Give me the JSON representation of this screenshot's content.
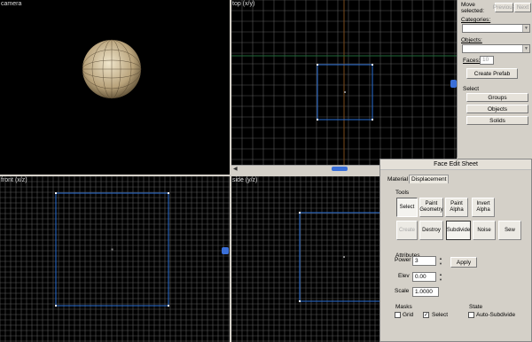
{
  "viewports": {
    "camera": "camera",
    "top": "top (x/y)",
    "front": "front (x/z)",
    "side": "side (y/z)"
  },
  "panel": {
    "move_selected": "Move selected:",
    "prev": "Previous",
    "next": "Next",
    "categories": "Categories:",
    "objects": "Objects:",
    "faces": "Faces:",
    "faces_value": "10",
    "create_prefab": "Create Prefab",
    "select": "Select",
    "groups": "Groups",
    "objects_btn": "Objects",
    "solids": "Solids"
  },
  "face_sheet": {
    "title": "Face Edit Sheet",
    "tab_material": "Material",
    "tab_displacement": "Displacement",
    "tools_label": "Tools",
    "tools": [
      "Select",
      "Paint Geometry",
      "Paint Alpha",
      "Invert Alpha",
      "Create",
      "Destroy",
      "Subdivide",
      "Noise",
      "Sew"
    ],
    "attributes_label": "Attributes",
    "power_label": "Power",
    "power_value": "3",
    "apply": "Apply",
    "elev_label": "Elev",
    "elev_value": "0.00",
    "scale_label": "Scale",
    "scale_value": "1.0000",
    "masks_label": "Masks",
    "grid": "Grid",
    "select_mask": "Select",
    "state_label": "State",
    "auto_subdivide": "Auto-Subdivide"
  },
  "colors": {
    "viewport_bg": "#000000",
    "grid_line": "#5a5a5a",
    "axis": "#7a4a1a",
    "selection": "#2a6fd6"
  }
}
